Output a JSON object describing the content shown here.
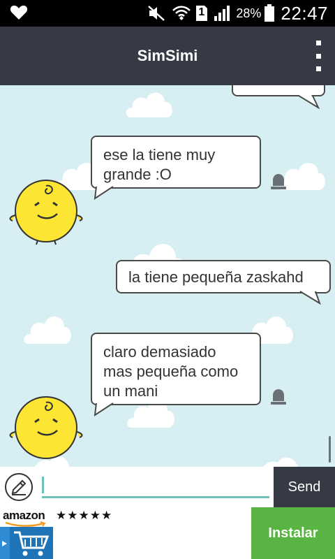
{
  "status_bar": {
    "battery_percent": "28%",
    "sim_slot": "1",
    "time": "22:47"
  },
  "app_bar": {
    "title": "SimSimi"
  },
  "messages": [
    {
      "sender": "simsimi",
      "text": "ese la tiene muy grande :O"
    },
    {
      "sender": "user",
      "text": "la tiene pequeña zaskahd"
    },
    {
      "sender": "simsimi",
      "text": "claro demasiado mas pequeña como un mani"
    }
  ],
  "input": {
    "value": "",
    "placeholder": "",
    "send_label": "Send"
  },
  "ad": {
    "brand": "amazon",
    "rating_stars": "★★★★★",
    "install_label": "Instalar"
  },
  "colors": {
    "app_bar": "#353a45",
    "chat_background": "#d7eef3",
    "install_button": "#59b443",
    "input_accent": "#6cc3b9",
    "simsimi_body": "#fde533"
  }
}
